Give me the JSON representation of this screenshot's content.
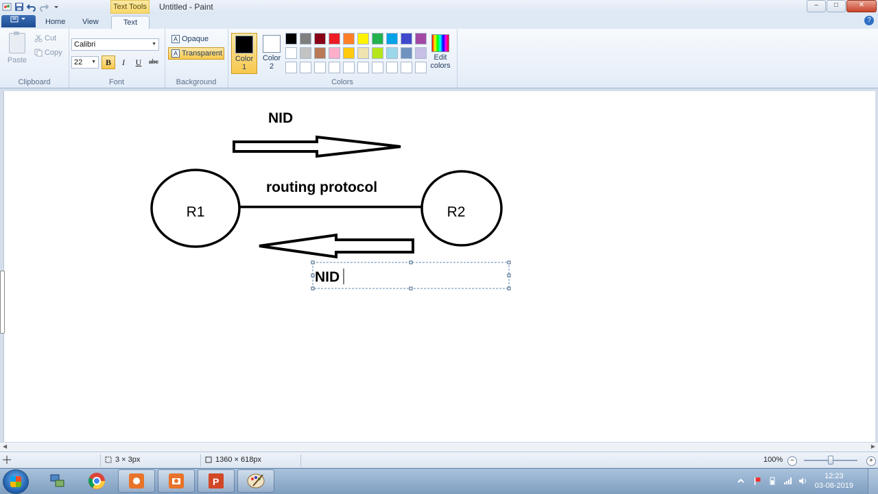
{
  "window": {
    "title": "Untitled - Paint",
    "contextual_tab": "Text Tools",
    "controls": {
      "minimize": "–",
      "maximize": "□",
      "close": "✕"
    }
  },
  "tabs": [
    {
      "label": "Home",
      "active": false
    },
    {
      "label": "View",
      "active": false
    },
    {
      "label": "Text",
      "active": true
    }
  ],
  "ribbon": {
    "clipboard": {
      "group": "Clipboard",
      "paste": "Paste",
      "cut": "Cut",
      "copy": "Copy"
    },
    "font": {
      "group": "Font",
      "family": "Calibri",
      "size": "22",
      "bold": "B",
      "italic": "I",
      "underline": "U",
      "strikethrough": "abc",
      "bold_on": true
    },
    "background": {
      "group": "Background",
      "opaque": "Opaque",
      "transparent": "Transparent",
      "selected": "transparent"
    },
    "colors": {
      "group": "Colors",
      "color1": {
        "label_line1": "Color",
        "label_line2": "1",
        "value": "#000000"
      },
      "color2": {
        "label_line1": "Color",
        "label_line2": "2",
        "value": "#ffffff"
      },
      "palette_row1": [
        "#000000",
        "#7f7f7f",
        "#880015",
        "#ed1c24",
        "#ff7f27",
        "#fff200",
        "#22b14c",
        "#00a2e8",
        "#3f48cc",
        "#a349a4"
      ],
      "palette_row2": [
        "#ffffff",
        "#c3c3c3",
        "#b97a57",
        "#ffaec9",
        "#ffc90e",
        "#efe4b0",
        "#b5e61d",
        "#99d9ea",
        "#7092be",
        "#c8bfe7"
      ],
      "palette_row3": [
        "#ffffff",
        "#ffffff",
        "#ffffff",
        "#ffffff",
        "#ffffff",
        "#ffffff",
        "#ffffff",
        "#ffffff",
        "#ffffff",
        "#ffffff"
      ],
      "edit_line1": "Edit",
      "edit_line2": "colors"
    }
  },
  "drawing": {
    "top_label": "NID",
    "link_label": "routing protocol",
    "node_left": "R1",
    "node_right": "R2",
    "editing_text": "NID"
  },
  "status": {
    "selection_size": "3 × 3px",
    "image_size": "1360 × 618px",
    "zoom": "100%"
  },
  "taskbar": {
    "time": "12:23",
    "date": "03-08-2019"
  }
}
